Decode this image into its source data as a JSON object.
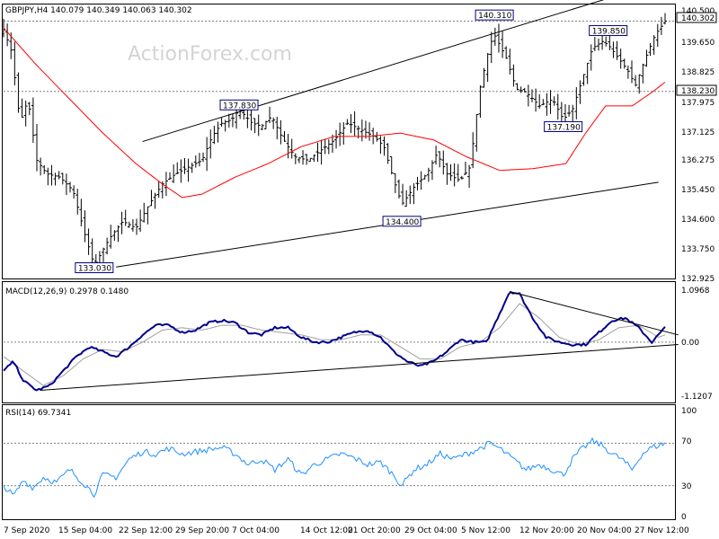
{
  "chart_data": [
    {
      "type": "ohlc",
      "header": "GBPJPY,H4  140.079 140.349 140.063 140.302",
      "watermark": "ActionForex.com",
      "ylim": [
        132.925,
        140.5
      ],
      "y_ticks": [
        "140.500",
        "139.650",
        "138.825",
        "137.975",
        "137.125",
        "136.275",
        "135.450",
        "134.600",
        "133.750",
        "132.925"
      ],
      "x_tick_labels": [
        "7 Sep 2020",
        "15 Sep 04:00",
        "22 Sep 12:00",
        "29 Sep 20:00",
        "7 Oct 04:00",
        "14 Oct 12:00",
        "21 Oct 20:00",
        "29 Oct 04:00",
        "5 Nov 12:00",
        "12 Nov 20:00",
        "20 Nov 04:00",
        "27 Nov 12:00"
      ],
      "current_price": "140.302",
      "horizontal_levels": [
        {
          "label": "140.302",
          "value": 140.302,
          "style": "dotted"
        },
        {
          "label": "138.230",
          "value": 138.23,
          "style": "dotted"
        }
      ],
      "annotations": [
        {
          "label": "133.030",
          "value": 133.03,
          "t": 0.137
        },
        {
          "label": "137.830",
          "value": 137.83,
          "t": 0.356
        },
        {
          "label": "134.400",
          "value": 134.4,
          "t": 0.602
        },
        {
          "label": "140.310",
          "value": 140.31,
          "t": 0.742
        },
        {
          "label": "137.190",
          "value": 137.19,
          "t": 0.846
        },
        {
          "label": "139.850",
          "value": 139.85,
          "t": 0.914
        }
      ],
      "price_anchors": [
        [
          0.0,
          140.05
        ],
        [
          0.012,
          139.4
        ],
        [
          0.025,
          137.3
        ],
        [
          0.037,
          138.0
        ],
        [
          0.05,
          136.2
        ],
        [
          0.065,
          135.8
        ],
        [
          0.085,
          135.7
        ],
        [
          0.105,
          135.3
        ],
        [
          0.123,
          134.0
        ],
        [
          0.137,
          133.1
        ],
        [
          0.16,
          133.9
        ],
        [
          0.18,
          134.4
        ],
        [
          0.2,
          134.2
        ],
        [
          0.22,
          134.9
        ],
        [
          0.24,
          135.5
        ],
        [
          0.26,
          135.8
        ],
        [
          0.28,
          136.0
        ],
        [
          0.3,
          136.2
        ],
        [
          0.315,
          136.9
        ],
        [
          0.33,
          137.3
        ],
        [
          0.345,
          137.4
        ],
        [
          0.356,
          137.7
        ],
        [
          0.375,
          137.3
        ],
        [
          0.39,
          137.2
        ],
        [
          0.405,
          137.5
        ],
        [
          0.42,
          136.9
        ],
        [
          0.44,
          136.3
        ],
        [
          0.46,
          136.2
        ],
        [
          0.48,
          136.5
        ],
        [
          0.5,
          136.8
        ],
        [
          0.52,
          137.3
        ],
        [
          0.54,
          137.1
        ],
        [
          0.56,
          136.9
        ],
        [
          0.575,
          136.6
        ],
        [
          0.59,
          135.6
        ],
        [
          0.602,
          134.9
        ],
        [
          0.62,
          135.4
        ],
        [
          0.64,
          135.8
        ],
        [
          0.655,
          136.4
        ],
        [
          0.67,
          135.8
        ],
        [
          0.69,
          135.6
        ],
        [
          0.705,
          136.0
        ],
        [
          0.72,
          138.3
        ],
        [
          0.735,
          139.6
        ],
        [
          0.742,
          139.9
        ],
        [
          0.76,
          139.2
        ],
        [
          0.775,
          138.3
        ],
        [
          0.79,
          138.2
        ],
        [
          0.81,
          137.8
        ],
        [
          0.83,
          138.0
        ],
        [
          0.846,
          137.4
        ],
        [
          0.86,
          137.7
        ],
        [
          0.875,
          138.6
        ],
        [
          0.89,
          139.5
        ],
        [
          0.905,
          139.7
        ],
        [
          0.914,
          139.6
        ],
        [
          0.93,
          139.2
        ],
        [
          0.945,
          138.8
        ],
        [
          0.955,
          138.4
        ],
        [
          0.97,
          139.2
        ],
        [
          0.985,
          139.9
        ],
        [
          1.0,
          140.3
        ]
      ],
      "moving_average": {
        "color": "#ff0000",
        "anchors": [
          [
            0.0,
            140.1
          ],
          [
            0.05,
            139.0
          ],
          [
            0.1,
            138.0
          ],
          [
            0.15,
            137.0
          ],
          [
            0.2,
            136.1
          ],
          [
            0.24,
            135.5
          ],
          [
            0.27,
            135.1
          ],
          [
            0.3,
            135.2
          ],
          [
            0.35,
            135.7
          ],
          [
            0.4,
            136.1
          ],
          [
            0.45,
            136.6
          ],
          [
            0.5,
            136.9
          ],
          [
            0.55,
            136.9
          ],
          [
            0.6,
            137.0
          ],
          [
            0.65,
            136.8
          ],
          [
            0.7,
            136.3
          ],
          [
            0.75,
            135.9
          ],
          [
            0.8,
            135.95
          ],
          [
            0.85,
            136.1
          ],
          [
            0.88,
            137.0
          ],
          [
            0.91,
            137.8
          ],
          [
            0.95,
            137.8
          ],
          [
            0.98,
            138.2
          ],
          [
            1.0,
            138.5
          ]
        ]
      },
      "trendlines": [
        {
          "from": [
            0.21,
            136.75
          ],
          "to": [
            0.96,
            141.25
          ]
        },
        {
          "from": [
            0.17,
            133.05
          ],
          "to": [
            0.99,
            135.55
          ]
        }
      ]
    },
    {
      "type": "line",
      "header": "MACD(12,26,9) 0.2978 0.1480",
      "ylim": [
        -1.1207,
        1.0968
      ],
      "y_ticks": [
        "1.0968",
        "0.00",
        "-1.1207"
      ],
      "zero_line": 0.0,
      "macd_color": "#00008b",
      "signal_color": "#a0a0a0",
      "macd_anchors": [
        [
          0.0,
          -0.6
        ],
        [
          0.015,
          -0.4
        ],
        [
          0.03,
          -0.8
        ],
        [
          0.05,
          -1.0
        ],
        [
          0.07,
          -0.9
        ],
        [
          0.09,
          -0.6
        ],
        [
          0.11,
          -0.3
        ],
        [
          0.13,
          -0.1
        ],
        [
          0.15,
          -0.2
        ],
        [
          0.17,
          -0.3
        ],
        [
          0.19,
          -0.1
        ],
        [
          0.21,
          0.15
        ],
        [
          0.23,
          0.35
        ],
        [
          0.25,
          0.35
        ],
        [
          0.27,
          0.2
        ],
        [
          0.29,
          0.25
        ],
        [
          0.31,
          0.4
        ],
        [
          0.33,
          0.45
        ],
        [
          0.35,
          0.4
        ],
        [
          0.37,
          0.2
        ],
        [
          0.39,
          0.15
        ],
        [
          0.41,
          0.3
        ],
        [
          0.43,
          0.3
        ],
        [
          0.45,
          0.1
        ],
        [
          0.47,
          0.0
        ],
        [
          0.49,
          0.0
        ],
        [
          0.51,
          0.1
        ],
        [
          0.53,
          0.2
        ],
        [
          0.55,
          0.25
        ],
        [
          0.57,
          0.1
        ],
        [
          0.59,
          -0.2
        ],
        [
          0.61,
          -0.4
        ],
        [
          0.63,
          -0.5
        ],
        [
          0.65,
          -0.4
        ],
        [
          0.67,
          -0.2
        ],
        [
          0.69,
          0.05
        ],
        [
          0.71,
          0.0
        ],
        [
          0.73,
          0.0
        ],
        [
          0.75,
          0.6
        ],
        [
          0.765,
          1.05
        ],
        [
          0.78,
          1.0
        ],
        [
          0.8,
          0.5
        ],
        [
          0.82,
          0.1
        ],
        [
          0.84,
          0.0
        ],
        [
          0.86,
          -0.05
        ],
        [
          0.88,
          -0.05
        ],
        [
          0.9,
          0.2
        ],
        [
          0.92,
          0.45
        ],
        [
          0.94,
          0.5
        ],
        [
          0.96,
          0.3
        ],
        [
          0.98,
          0.0
        ],
        [
          1.0,
          0.3
        ]
      ],
      "signal_anchors": [
        [
          0.0,
          -0.3
        ],
        [
          0.03,
          -0.6
        ],
        [
          0.06,
          -0.9
        ],
        [
          0.09,
          -0.7
        ],
        [
          0.12,
          -0.35
        ],
        [
          0.15,
          -0.15
        ],
        [
          0.18,
          -0.2
        ],
        [
          0.21,
          0.0
        ],
        [
          0.24,
          0.25
        ],
        [
          0.27,
          0.3
        ],
        [
          0.3,
          0.25
        ],
        [
          0.33,
          0.35
        ],
        [
          0.36,
          0.35
        ],
        [
          0.39,
          0.25
        ],
        [
          0.42,
          0.2
        ],
        [
          0.45,
          0.15
        ],
        [
          0.48,
          0.05
        ],
        [
          0.51,
          0.05
        ],
        [
          0.54,
          0.15
        ],
        [
          0.57,
          0.15
        ],
        [
          0.6,
          -0.1
        ],
        [
          0.63,
          -0.35
        ],
        [
          0.66,
          -0.35
        ],
        [
          0.69,
          -0.1
        ],
        [
          0.72,
          0.0
        ],
        [
          0.75,
          0.3
        ],
        [
          0.78,
          0.8
        ],
        [
          0.81,
          0.5
        ],
        [
          0.84,
          0.1
        ],
        [
          0.87,
          -0.05
        ],
        [
          0.9,
          0.05
        ],
        [
          0.93,
          0.3
        ],
        [
          0.96,
          0.35
        ],
        [
          0.99,
          0.1
        ],
        [
          1.0,
          0.15
        ]
      ],
      "trendlines": [
        {
          "from": [
            0.055,
            -1.0
          ],
          "to": [
            1.02,
            -0.05
          ]
        },
        {
          "from": [
            0.765,
            1.05
          ],
          "to": [
            1.02,
            0.15
          ]
        }
      ]
    },
    {
      "type": "line",
      "header": "RSI(14) 69.7341",
      "ylim": [
        0,
        100
      ],
      "y_ticks": [
        "100",
        "70",
        "30",
        "0"
      ],
      "levels": [
        70,
        30
      ],
      "color": "#1e90ff",
      "anchors": [
        [
          0.0,
          30
        ],
        [
          0.015,
          20
        ],
        [
          0.03,
          35
        ],
        [
          0.045,
          28
        ],
        [
          0.06,
          38
        ],
        [
          0.08,
          33
        ],
        [
          0.1,
          45
        ],
        [
          0.12,
          33
        ],
        [
          0.137,
          22
        ],
        [
          0.15,
          40
        ],
        [
          0.17,
          38
        ],
        [
          0.19,
          55
        ],
        [
          0.21,
          62
        ],
        [
          0.23,
          60
        ],
        [
          0.25,
          65
        ],
        [
          0.27,
          60
        ],
        [
          0.29,
          62
        ],
        [
          0.31,
          64
        ],
        [
          0.33,
          66
        ],
        [
          0.35,
          60
        ],
        [
          0.37,
          50
        ],
        [
          0.39,
          55
        ],
        [
          0.41,
          45
        ],
        [
          0.43,
          55
        ],
        [
          0.45,
          40
        ],
        [
          0.47,
          50
        ],
        [
          0.49,
          55
        ],
        [
          0.51,
          60
        ],
        [
          0.53,
          56
        ],
        [
          0.55,
          50
        ],
        [
          0.57,
          52
        ],
        [
          0.59,
          40
        ],
        [
          0.602,
          30
        ],
        [
          0.62,
          45
        ],
        [
          0.64,
          50
        ],
        [
          0.66,
          60
        ],
        [
          0.68,
          55
        ],
        [
          0.7,
          60
        ],
        [
          0.72,
          65
        ],
        [
          0.735,
          70
        ],
        [
          0.75,
          65
        ],
        [
          0.77,
          55
        ],
        [
          0.79,
          45
        ],
        [
          0.81,
          50
        ],
        [
          0.83,
          45
        ],
        [
          0.846,
          40
        ],
        [
          0.86,
          55
        ],
        [
          0.875,
          65
        ],
        [
          0.89,
          72
        ],
        [
          0.905,
          68
        ],
        [
          0.92,
          60
        ],
        [
          0.935,
          55
        ],
        [
          0.95,
          45
        ],
        [
          0.965,
          60
        ],
        [
          0.98,
          66
        ],
        [
          1.0,
          70
        ]
      ]
    }
  ]
}
